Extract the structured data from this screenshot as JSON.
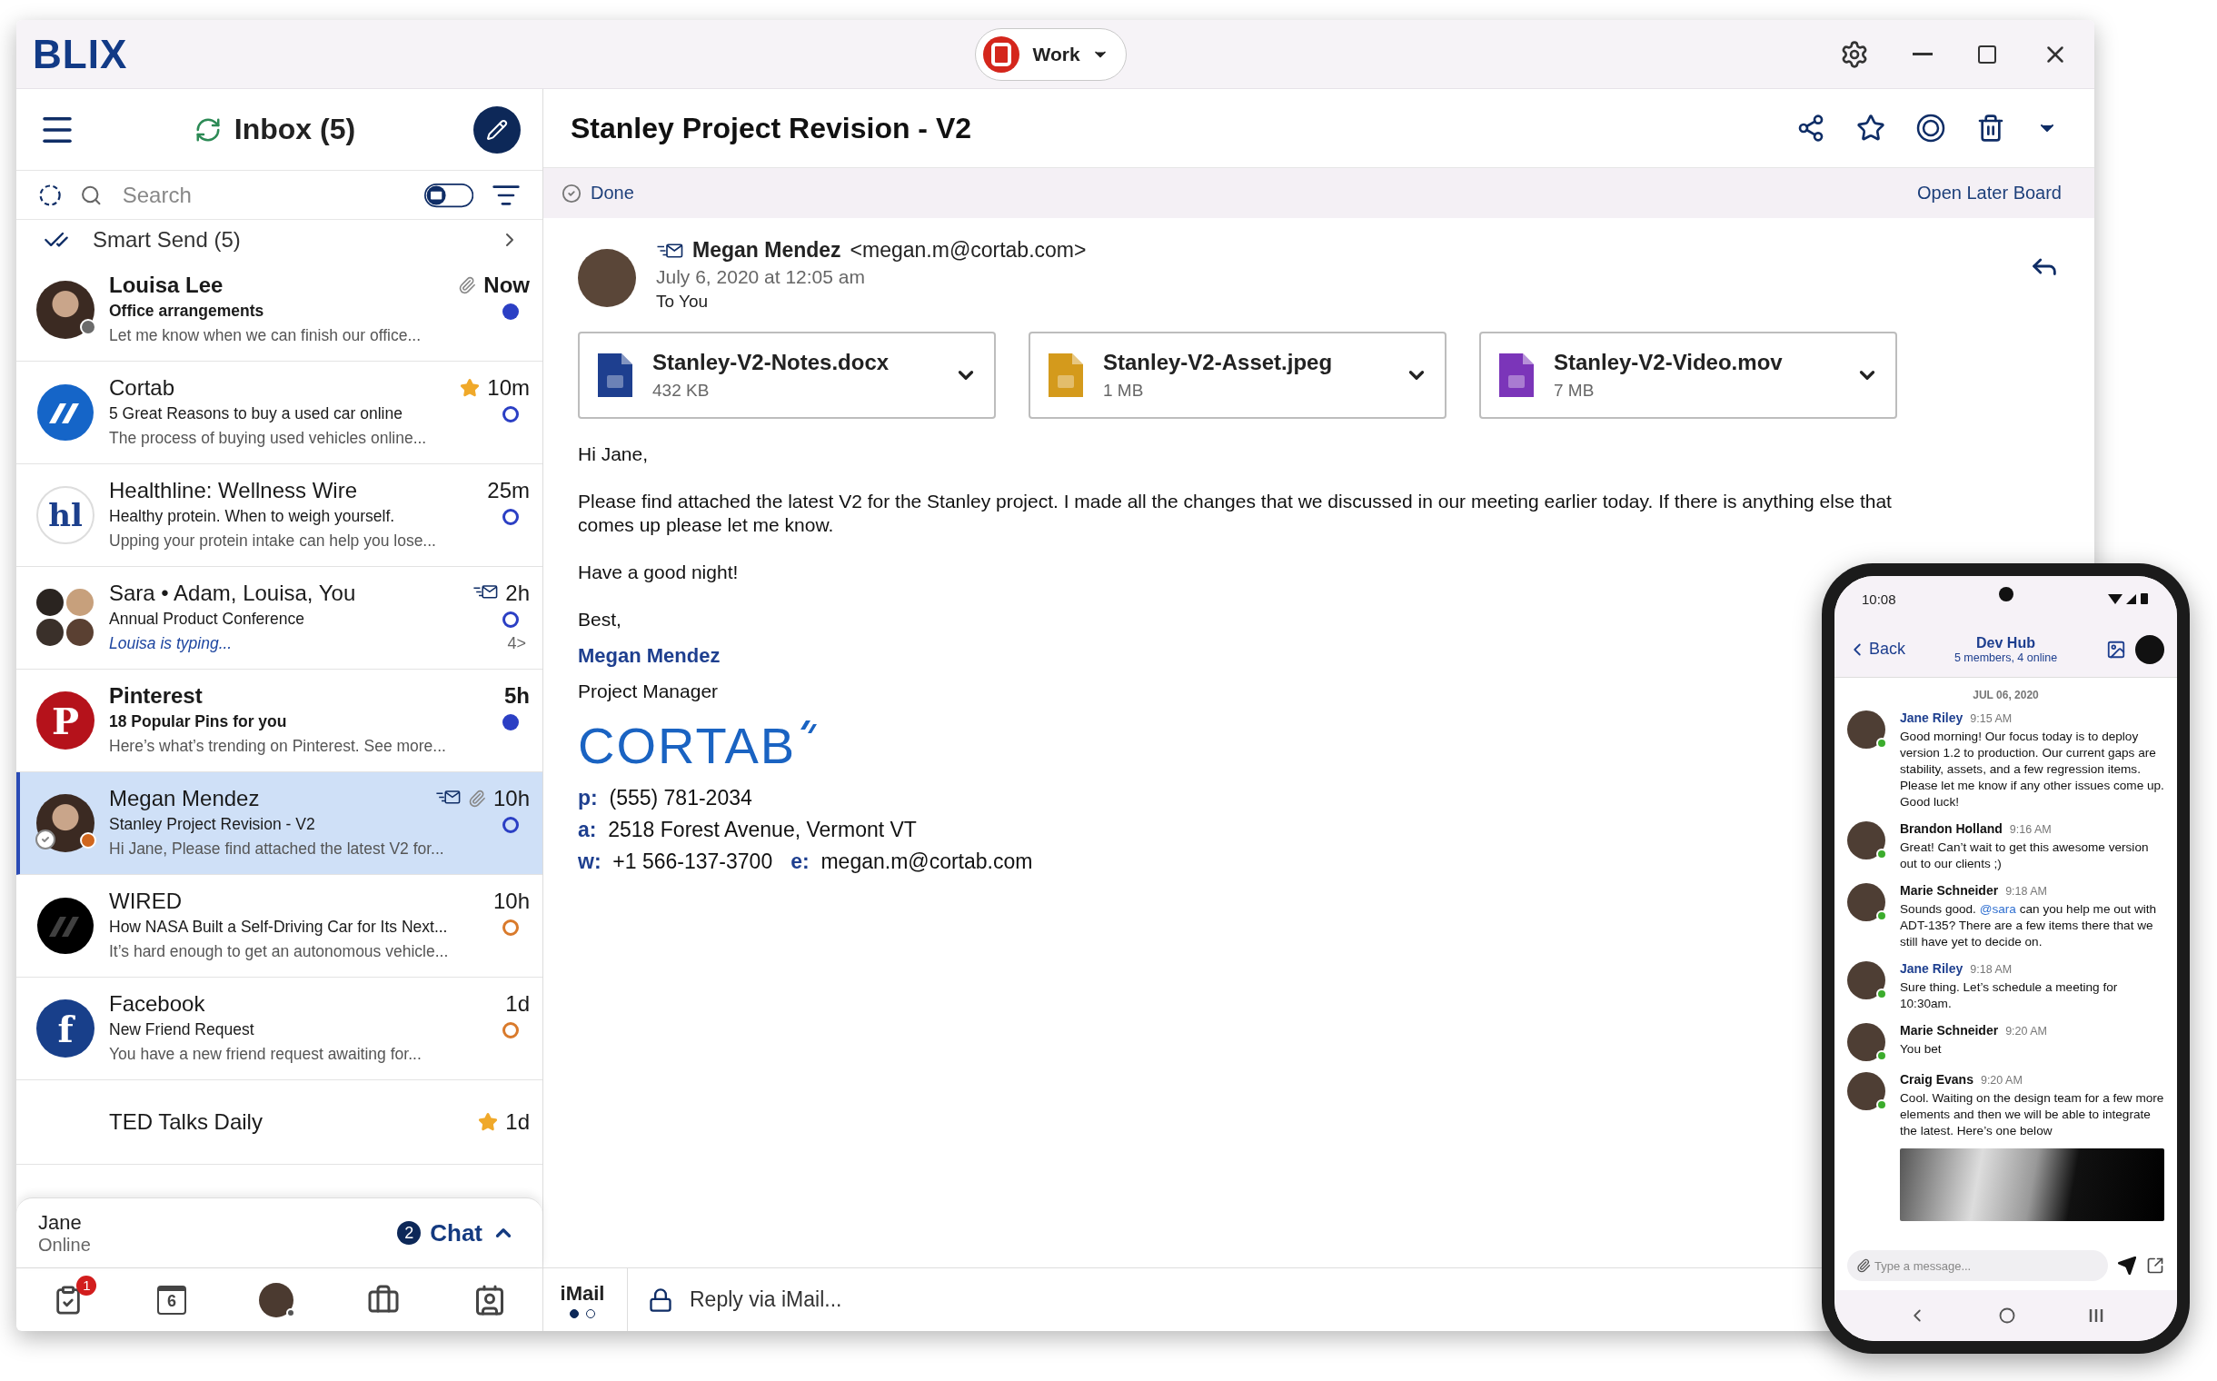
{
  "title_bar": {
    "logo": "BLIX",
    "account": "Work"
  },
  "inbox": {
    "title": "Inbox (5)",
    "search_placeholder": "Search",
    "mail_toggle": {
      "on": false
    },
    "smart_send": "Smart Send (5)",
    "rows": [
      {
        "name": "Louisa Lee",
        "subject": "Office arrangements",
        "preview": "Let me know when we can finish our office...",
        "time": "Now",
        "unread": true,
        "color": "#2b3fc4",
        "attachment": true,
        "star": false,
        "smart_send": false,
        "typing": false,
        "selected": false,
        "avatar": {
          "kind": "photo",
          "color": "#6b6b6b"
        }
      },
      {
        "name": "Cortab",
        "subject": "5 Great Reasons to buy a used car online",
        "preview": "The process of buying used vehicles online...",
        "time": "10m",
        "unread": false,
        "color": "#2b3fc4",
        "attachment": false,
        "star": true,
        "smart_send": false,
        "typing": false,
        "selected": false,
        "avatar": {
          "kind": "stripes",
          "color": "#1565c8"
        }
      },
      {
        "name": "Healthline: Wellness Wire",
        "subject": "Healthy protein. When to weigh yourself.",
        "preview": "Upping your protein intake can help you lose...",
        "time": "25m",
        "unread": false,
        "color": "#2b3fc4",
        "attachment": false,
        "star": false,
        "smart_send": false,
        "typing": false,
        "selected": false,
        "avatar": {
          "kind": "monogram-outline",
          "text": "hl",
          "color": "#1c3f8c"
        }
      },
      {
        "name": "Sara • Adam, Louisa, You",
        "subject": "Annual Product Conference",
        "preview": "Louisa is typing...",
        "time": "2h",
        "count": "4>",
        "unread": false,
        "color": "#2b3fc4",
        "attachment": false,
        "star": false,
        "smart_send": true,
        "typing": true,
        "selected": false,
        "avatar": {
          "kind": "group"
        }
      },
      {
        "name": "Pinterest",
        "subject": "18 Popular Pins for you",
        "preview": "Here’s what’s trending on Pinterest. See more...",
        "time": "5h",
        "unread": true,
        "color": "#2b3fc4",
        "attachment": false,
        "star": false,
        "smart_send": false,
        "typing": false,
        "selected": false,
        "avatar": {
          "kind": "monogram",
          "text": "P",
          "color": "#b5121b"
        }
      },
      {
        "name": "Megan Mendez",
        "subject": "Stanley Project Revision - V2",
        "preview": "Hi Jane, Please find attached the latest V2 for...",
        "time": "10h",
        "unread": false,
        "color": "#2b3fc4",
        "attachment": true,
        "star": false,
        "smart_send": true,
        "typing": false,
        "selected": true,
        "avatar": {
          "kind": "photo",
          "color": "#d0661e"
        }
      },
      {
        "name": "WIRED",
        "subject": "How NASA Built a Self-Driving Car for Its Next...",
        "preview": "It’s hard enough to get an autonomous vehicle...",
        "time": "10h",
        "unread": false,
        "color": "#d97a2b",
        "attachment": false,
        "star": false,
        "smart_send": false,
        "typing": false,
        "selected": false,
        "avatar": {
          "kind": "stripes",
          "color": "#000000"
        }
      },
      {
        "name": "Facebook",
        "subject": "New Friend Request",
        "preview": "You have a new friend request awaiting for...",
        "time": "1d",
        "unread": false,
        "color": "#d97a2b",
        "attachment": false,
        "star": false,
        "smart_send": false,
        "typing": false,
        "selected": false,
        "avatar": {
          "kind": "monogram",
          "text": "f",
          "color": "#183f8a"
        }
      },
      {
        "name": "TED Talks Daily",
        "time": "1d",
        "unread": false,
        "attachment": false,
        "star": true,
        "smart_send": false,
        "typing": false,
        "selected": false
      }
    ],
    "chat_bar": {
      "user": "Jane",
      "status": "Online",
      "badge": "2",
      "label": "Chat"
    },
    "nav": [
      {
        "kind": "tasks",
        "badge": "1"
      },
      {
        "kind": "calendar",
        "text": "6"
      },
      {
        "kind": "avatar"
      },
      {
        "kind": "briefcase"
      },
      {
        "kind": "contacts"
      }
    ]
  },
  "email": {
    "title": "Stanley Project Revision - V2",
    "done": "Done",
    "later": "Open Later Board",
    "sender": {
      "name": "Megan Mendez",
      "address": "<megan.m@cortab.com>",
      "date": "July 6, 2020 at 12:05 am",
      "to": "To You"
    },
    "attachments": [
      {
        "name": "Stanley-V2-Notes.docx",
        "size": "432 KB",
        "kind": "doc"
      },
      {
        "name": "Stanley-V2-Asset.jpeg",
        "size": "1 MB",
        "kind": "image"
      },
      {
        "name": "Stanley-V2-Video.mov",
        "size": "7 MB",
        "kind": "video"
      }
    ],
    "body": [
      "Hi Jane,",
      "Please find attached the latest V2 for the Stanley project. I made all the changes that we discussed in our meeting earlier today. If there is anything else that comes up please let me know.",
      "Have a good night!",
      "Best,"
    ],
    "signature": {
      "name": "Megan Mendez",
      "role": "Project Manager",
      "logo": "CORTAB",
      "lines": [
        [
          {
            "label": "p:",
            "value": "(555) 781-2034"
          }
        ],
        [
          {
            "label": "a:",
            "value": "2518 Forest Avenue, Vermont VT"
          }
        ],
        [
          {
            "label": "w:",
            "value": "+1 566-137-3700"
          },
          {
            "label": "e:",
            "value": "megan.m@cortab.com"
          }
        ]
      ]
    },
    "footer": {
      "label": "iMail",
      "pages": [
        {
          "selected": true
        },
        {
          "selected": false
        }
      ],
      "placeholder": "Reply via iMail..."
    }
  },
  "phone": {
    "time": "10:08",
    "back": "Back",
    "group": "Dev Hub",
    "members": "5 members, 4 online",
    "date": "JUL 06, 2020",
    "messages": [
      {
        "name": "Jane Riley",
        "color": "#1e3f8f",
        "time": "9:15 AM",
        "text": [
          {
            "text": "Good morning! Our focus today is to deploy version 1.2 to production. Our current gaps are stability, assets, and a few regression items. Please let me know if any other issues come up. Good luck!"
          }
        ]
      },
      {
        "name": "Brandon Holland",
        "color": "#111111",
        "time": "9:16 AM",
        "text": [
          {
            "text": "Great! Can’t wait to get this awesome version out to our clients ;)"
          }
        ]
      },
      {
        "name": "Marie Schneider",
        "color": "#111111",
        "time": "9:18 AM",
        "text": [
          {
            "text": "Sounds good. "
          },
          {
            "text": "@sara",
            "kind": "mention"
          },
          {
            "text": " can you help me out with ADT-135? There are a few items there that we still have yet to decide on."
          }
        ]
      },
      {
        "name": "Jane Riley",
        "color": "#1e3f8f",
        "time": "9:18 AM",
        "text": [
          {
            "text": "Sure thing. Let’s schedule a meeting for 10:30am."
          }
        ]
      },
      {
        "name": "Marie Schneider",
        "color": "#111111",
        "time": "9:20 AM",
        "text": [
          {
            "text": "You bet"
          }
        ]
      },
      {
        "name": "Craig Evans",
        "color": "#111111",
        "time": "9:20 AM",
        "text": [
          {
            "text": "Cool. Waiting on the design team for a few more elements and then we will be able to integrate the latest. Here’s one below"
          }
        ],
        "photo": true
      }
    ],
    "placeholder": "Type a message..."
  }
}
